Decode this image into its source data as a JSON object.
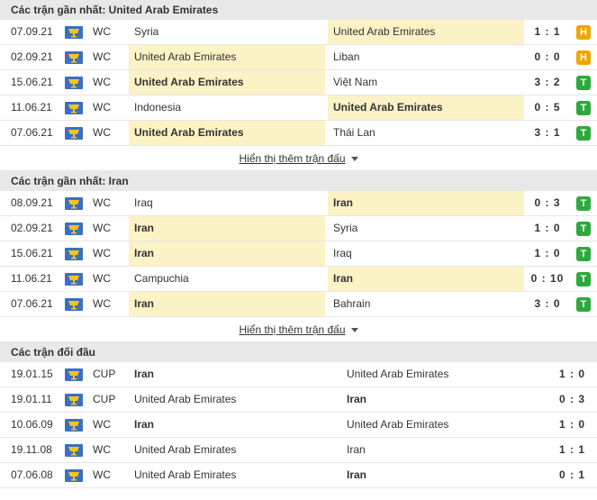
{
  "colors": {
    "highlight": "#fbf2c5",
    "draw": "#f0a500",
    "win": "#2ea93c",
    "header_bg": "#e8e8e8"
  },
  "icons": {
    "competition": "trophy-flag-icon",
    "expand": "caret-down-icon"
  },
  "uae_recent": {
    "title": "Các trận gần nhất: United Arab Emirates",
    "more_label": "Hiển thị thêm trận đấu",
    "matches": [
      {
        "date": "07.09.21",
        "comp": "WC",
        "home": "Syria",
        "away": "United Arab Emirates",
        "score": "1 : 1",
        "result": "H",
        "hl": "away",
        "bold": "none"
      },
      {
        "date": "02.09.21",
        "comp": "WC",
        "home": "United Arab Emirates",
        "away": "Liban",
        "score": "0 : 0",
        "result": "H",
        "hl": "home",
        "bold": "none"
      },
      {
        "date": "15.06.21",
        "comp": "WC",
        "home": "United Arab Emirates",
        "away": "Việt Nam",
        "score": "3 : 2",
        "result": "T",
        "hl": "home",
        "bold": "home"
      },
      {
        "date": "11.06.21",
        "comp": "WC",
        "home": "Indonesia",
        "away": "United Arab Emirates",
        "score": "0 : 5",
        "result": "T",
        "hl": "away",
        "bold": "away"
      },
      {
        "date": "07.06.21",
        "comp": "WC",
        "home": "United Arab Emirates",
        "away": "Thái Lan",
        "score": "3 : 1",
        "result": "T",
        "hl": "home",
        "bold": "home"
      }
    ]
  },
  "iran_recent": {
    "title": "Các trận gần nhất: Iran",
    "more_label": "Hiển thị thêm trận đấu",
    "matches": [
      {
        "date": "08.09.21",
        "comp": "WC",
        "home": "Iraq",
        "away": "Iran",
        "score": "0 : 3",
        "result": "T",
        "hl": "away",
        "bold": "away"
      },
      {
        "date": "02.09.21",
        "comp": "WC",
        "home": "Iran",
        "away": "Syria",
        "score": "1 : 0",
        "result": "T",
        "hl": "home",
        "bold": "home"
      },
      {
        "date": "15.06.21",
        "comp": "WC",
        "home": "Iran",
        "away": "Iraq",
        "score": "1 : 0",
        "result": "T",
        "hl": "home",
        "bold": "home"
      },
      {
        "date": "11.06.21",
        "comp": "WC",
        "home": "Campuchia",
        "away": "Iran",
        "score": "0 : 10",
        "result": "T",
        "hl": "away",
        "bold": "away"
      },
      {
        "date": "07.06.21",
        "comp": "WC",
        "home": "Iran",
        "away": "Bahrain",
        "score": "3 : 0",
        "result": "T",
        "hl": "home",
        "bold": "home"
      }
    ]
  },
  "h2h": {
    "title": "Các trận đối đầu",
    "matches": [
      {
        "date": "19.01.15",
        "comp": "CUP",
        "home": "Iran",
        "away": "United Arab Emirates",
        "score": "1 : 0",
        "bold": "home"
      },
      {
        "date": "19.01.11",
        "comp": "CUP",
        "home": "United Arab Emirates",
        "away": "Iran",
        "score": "0 : 3",
        "bold": "away"
      },
      {
        "date": "10.06.09",
        "comp": "WC",
        "home": "Iran",
        "away": "United Arab Emirates",
        "score": "1 : 0",
        "bold": "home"
      },
      {
        "date": "19.11.08",
        "comp": "WC",
        "home": "United Arab Emirates",
        "away": "Iran",
        "score": "1 : 1",
        "bold": "none"
      },
      {
        "date": "07.06.08",
        "comp": "WC",
        "home": "United Arab Emirates",
        "away": "Iran",
        "score": "0 : 1",
        "bold": "away"
      }
    ]
  }
}
